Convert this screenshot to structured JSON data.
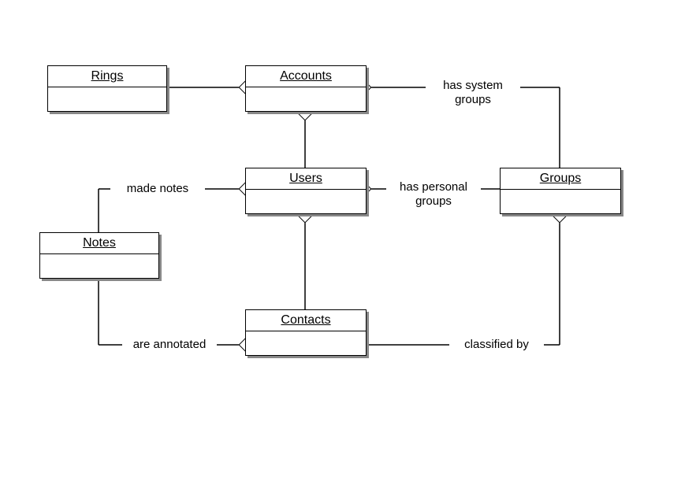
{
  "diagram": {
    "entities": {
      "rings": "Rings",
      "accounts": "Accounts",
      "users": "Users",
      "notes": "Notes",
      "contacts": "Contacts",
      "groups": "Groups"
    },
    "relationships": {
      "has_system_groups": "has system\ngroups",
      "has_personal_groups": "has personal\ngroups",
      "made_notes": "made notes",
      "are_annotated": "are annotated",
      "classified_by": "classified by"
    }
  }
}
